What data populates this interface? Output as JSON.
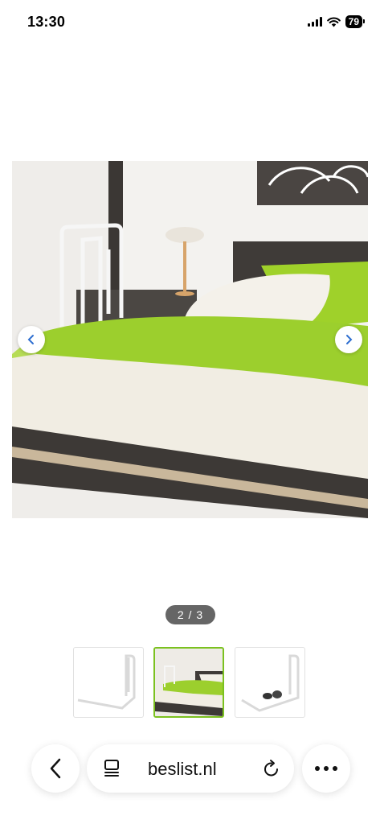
{
  "status_bar": {
    "time": "13:30",
    "battery": "79",
    "icons": [
      "signal-icon",
      "wifi-icon",
      "battery-icon"
    ]
  },
  "gallery": {
    "pager": "2 / 3",
    "thumbnails": [
      {
        "name": "thumbnail-1",
        "selected": false
      },
      {
        "name": "thumbnail-2",
        "selected": true
      },
      {
        "name": "thumbnail-3",
        "selected": false
      }
    ],
    "nav": {
      "prev_icon": "chevron-left-icon",
      "next_icon": "chevron-right-icon"
    }
  },
  "browser": {
    "url": "beslist.nl",
    "icons": [
      "back-arrow-icon",
      "tabs-icon",
      "reload-icon",
      "more-icon"
    ]
  },
  "colors": {
    "accent": "#7bc11f",
    "link": "#2f6fd0",
    "pager_bg": "#666666"
  }
}
